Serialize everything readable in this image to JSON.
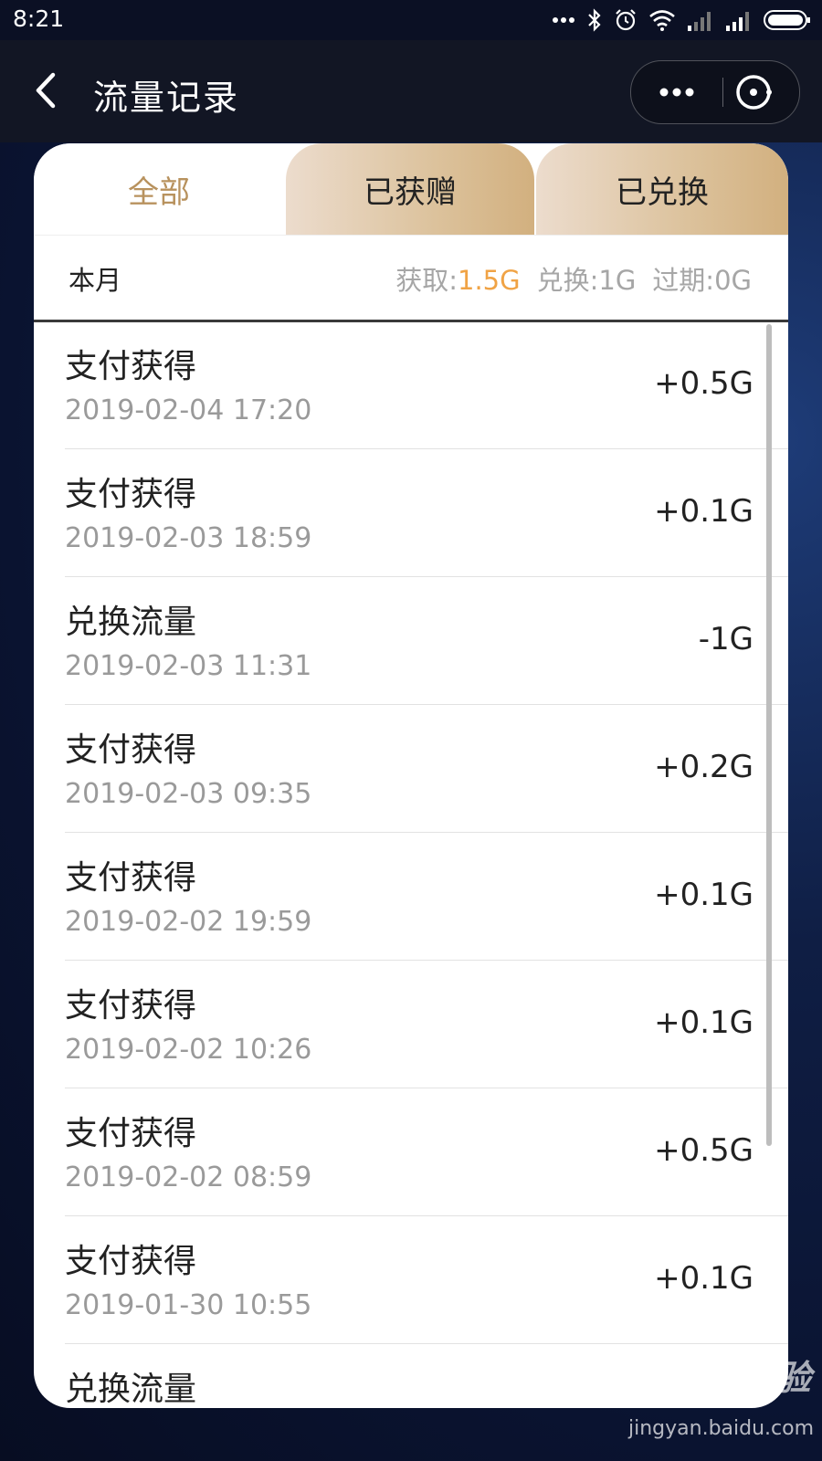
{
  "status_bar": {
    "time": "8:21"
  },
  "header": {
    "title": "流量记录"
  },
  "tabs": [
    {
      "label": "全部",
      "active": true
    },
    {
      "label": "已获赠",
      "active": false
    },
    {
      "label": "已兑换",
      "active": false
    }
  ],
  "summary": {
    "period": "本月",
    "obtain_label": "获取:",
    "obtain_value": "1.5G",
    "exchange_text": "兑换:1G",
    "expired_text": "过期:0G"
  },
  "records": [
    {
      "title": "支付获得",
      "date": "2019-02-04 17:20",
      "amount": "+0.5G"
    },
    {
      "title": "支付获得",
      "date": "2019-02-03 18:59",
      "amount": "+0.1G"
    },
    {
      "title": "兑换流量",
      "date": "2019-02-03 11:31",
      "amount": "-1G"
    },
    {
      "title": "支付获得",
      "date": "2019-02-03 09:35",
      "amount": "+0.2G"
    },
    {
      "title": "支付获得",
      "date": "2019-02-02 19:59",
      "amount": "+0.1G"
    },
    {
      "title": "支付获得",
      "date": "2019-02-02 10:26",
      "amount": "+0.1G"
    },
    {
      "title": "支付获得",
      "date": "2019-02-02 08:59",
      "amount": "+0.5G"
    },
    {
      "title": "支付获得",
      "date": "2019-01-30 10:55",
      "amount": "+0.1G"
    },
    {
      "title": "兑换流量",
      "date": "",
      "amount": ""
    }
  ],
  "watermark": {
    "logo": "Baidu经验",
    "url": "jingyan.baidu.com"
  },
  "colors": {
    "accent": "#f0a345",
    "active_tab_text": "#b8925e",
    "tab_gold": "#d2b07f"
  }
}
